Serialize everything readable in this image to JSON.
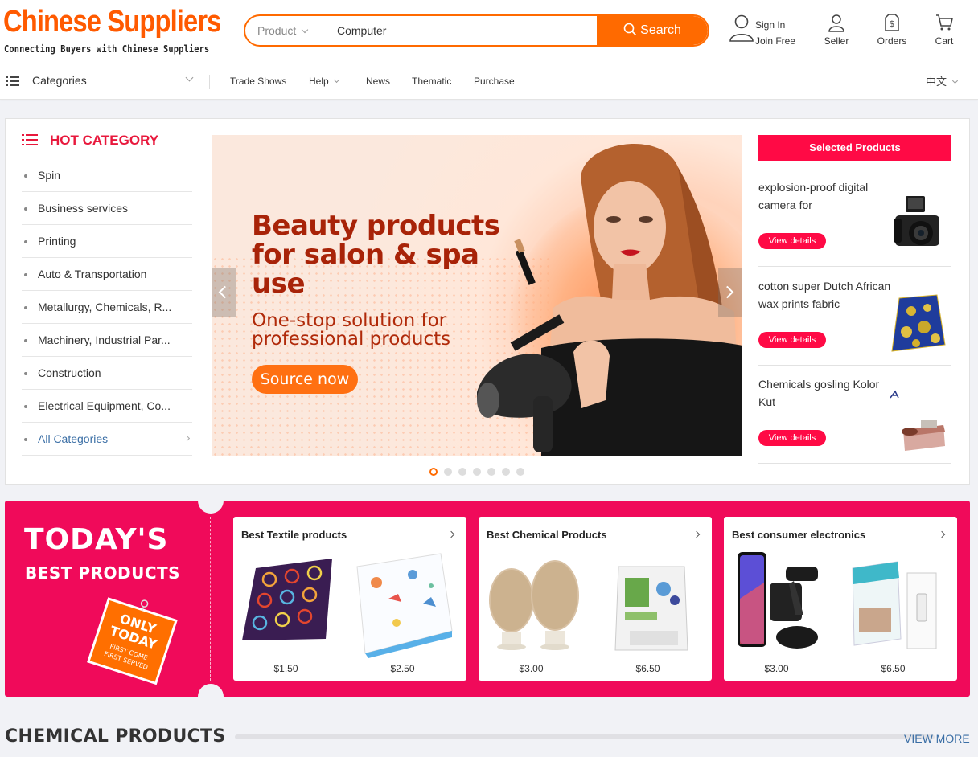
{
  "header": {
    "logo_title": "Chinese Suppliers",
    "logo_tagline": "Connecting Buyers with Chinese Suppliers",
    "search": {
      "category": "Product",
      "value": "Computer",
      "button": "Search"
    },
    "sign_in": "Sign In",
    "join_free": "Join Free",
    "seller": "Seller",
    "orders": "Orders",
    "cart": "Cart"
  },
  "nav": {
    "categories": "Categories",
    "links": [
      "Trade Shows",
      "Help",
      "News",
      "Thematic",
      "Purchase"
    ],
    "language": "中文"
  },
  "hot_category": {
    "title": "HOT CATEGORY",
    "items": [
      "Spin",
      "Business services",
      "Printing",
      "Auto & Transportation",
      "Metallurgy, Chemicals, R...",
      "Machinery, Industrial Par...",
      "Construction",
      "Electrical Equipment, Co...",
      "All Categories"
    ]
  },
  "banner": {
    "headline": "Beauty products for salon & spa use",
    "subline": "One-stop solution for professional products",
    "cta": "Source now",
    "slide_count": 7,
    "active_slide": 1
  },
  "selected_products": {
    "title": "Selected Products",
    "button_label": "View details",
    "items": [
      {
        "name": "explosion-proof digital camera for",
        "image": "camera-image"
      },
      {
        "name": "cotton super Dutch African wax prints fabric",
        "image": "fabric-image"
      },
      {
        "name": "Chemicals gosling Kolor Kut",
        "image": "chemical-kit-image"
      }
    ]
  },
  "todays_best": {
    "title": "TODAY'S",
    "subtitle": "BEST PRODUCTS",
    "tag_lines": [
      "ONLY",
      "TODAY",
      "FIRST COME",
      "FIRST SERVED"
    ],
    "cards": [
      {
        "title": "Best Textile products",
        "products": [
          {
            "price": "$1.50",
            "image": "african-print-fabric"
          },
          {
            "price": "$2.50",
            "image": "space-print-fabric"
          }
        ]
      },
      {
        "title": "Best Chemical Products",
        "products": [
          {
            "price": "$3.00",
            "image": "resin-granules"
          },
          {
            "price": "$6.50",
            "image": "chemical-bag"
          }
        ]
      },
      {
        "title": "Best consumer electronics",
        "products": [
          {
            "price": "$3.00",
            "image": "phone-car-mount"
          },
          {
            "price": "$6.50",
            "image": "smart-switch"
          }
        ]
      }
    ]
  },
  "chemical_section": {
    "title": "CHEMICAL PRODUCTS",
    "view_more": "VIEW MORE"
  },
  "colors": {
    "brand_orange": "#ff6a00",
    "accent_pink": "#ff0a45",
    "today_bg": "#f00a5a",
    "link_blue": "#3a6ea5"
  }
}
